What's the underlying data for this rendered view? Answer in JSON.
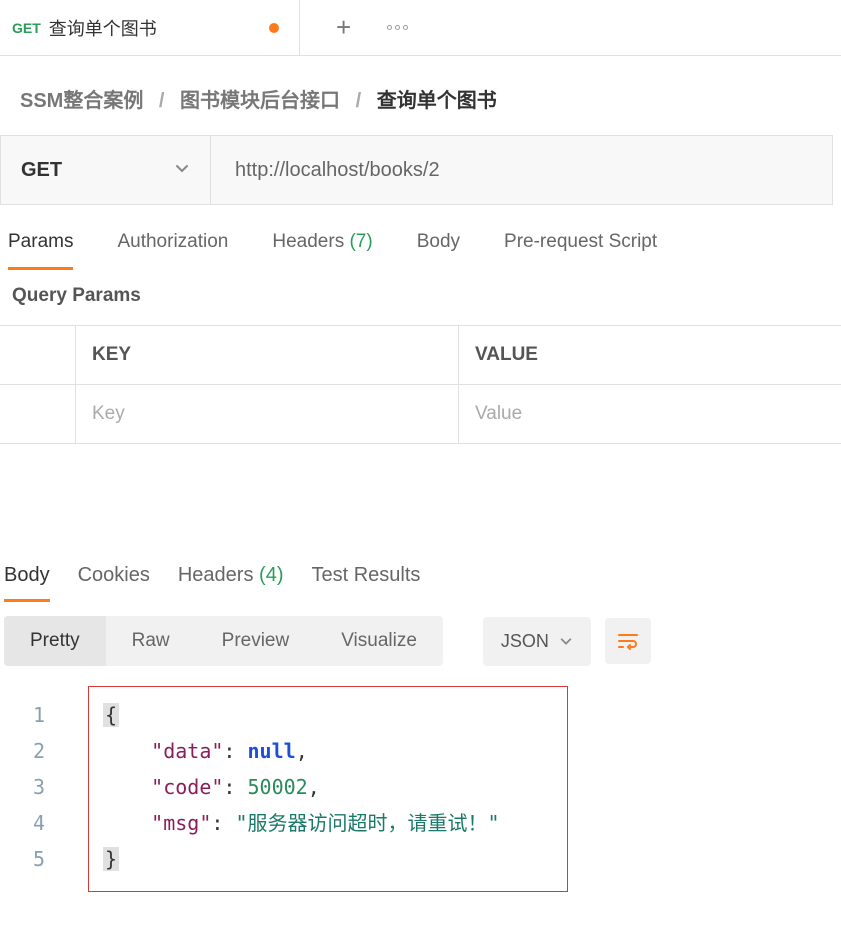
{
  "tab": {
    "method": "GET",
    "title": "查询单个图书"
  },
  "breadcrumb": {
    "a": "SSM整合案例",
    "b": "图书模块后台接口",
    "c": "查询单个图书"
  },
  "request": {
    "method": "GET",
    "url": "http://localhost/books/2"
  },
  "reqTabs": {
    "params": "Params",
    "auth": "Authorization",
    "headers": "Headers",
    "headersCount": "(7)",
    "body": "Body",
    "prereq": "Pre-request Script"
  },
  "queryParams": {
    "title": "Query Params",
    "keyHead": "KEY",
    "valHead": "VALUE",
    "keyPh": "Key",
    "valPh": "Value"
  },
  "respTabs": {
    "body": "Body",
    "cookies": "Cookies",
    "headers": "Headers",
    "headersCount": "(4)",
    "tests": "Test Results"
  },
  "fmt": {
    "pretty": "Pretty",
    "raw": "Raw",
    "preview": "Preview",
    "visualize": "Visualize",
    "json": "JSON"
  },
  "lines": {
    "l1": "1",
    "l2": "2",
    "l3": "3",
    "l4": "4",
    "l5": "5"
  },
  "json": {
    "open": "{",
    "k1": "\"data\"",
    "v1": "null",
    "k2": "\"code\"",
    "v2": "50002",
    "k3": "\"msg\"",
    "v3": "\"服务器访问超时，请重试！\"",
    "close": "}",
    "colon": ": ",
    "comma": ","
  }
}
